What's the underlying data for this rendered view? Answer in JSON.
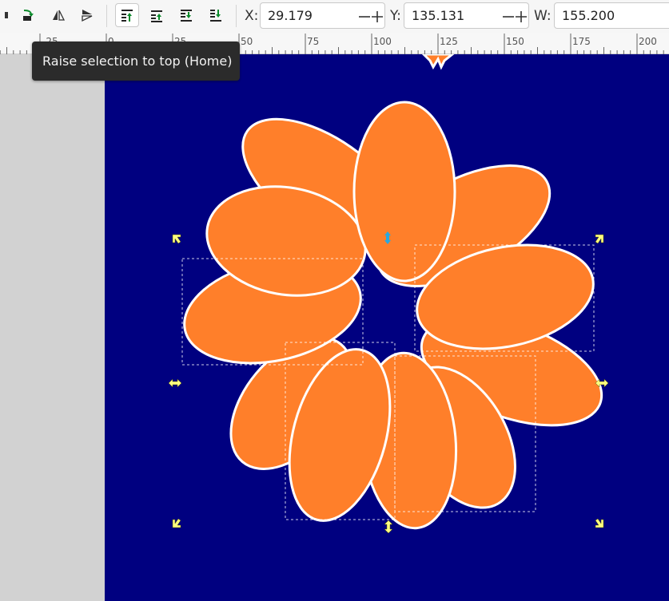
{
  "toolbar": {
    "buttons": [
      {
        "icon": "raise-one-step-icon"
      },
      {
        "icon": "flip-horizontal-icon"
      },
      {
        "icon": "flip-vertical-icon"
      },
      {
        "icon": "raise-to-top-icon"
      },
      {
        "icon": "raise-icon"
      },
      {
        "icon": "lower-icon"
      },
      {
        "icon": "lower-to-bottom-icon"
      }
    ],
    "x_label": "X:",
    "x_value": "29.179",
    "y_label": "Y:",
    "y_value": "135.131",
    "w_label": "W:",
    "w_value": "155.200"
  },
  "ruler": {
    "labels": [
      "-25",
      "0",
      "25",
      "50",
      "75",
      "100",
      "125",
      "150",
      "175",
      "200"
    ]
  },
  "tooltip": {
    "text": "Raise selection to top (Home)"
  },
  "colors": {
    "page_background": "#000080",
    "petal_fill": "#ff7f2a",
    "petal_stroke": "#ffffff",
    "handle": "#ffff80",
    "rotation_center": "#2aa8e0",
    "canvas_background": "#d2d2d2"
  }
}
